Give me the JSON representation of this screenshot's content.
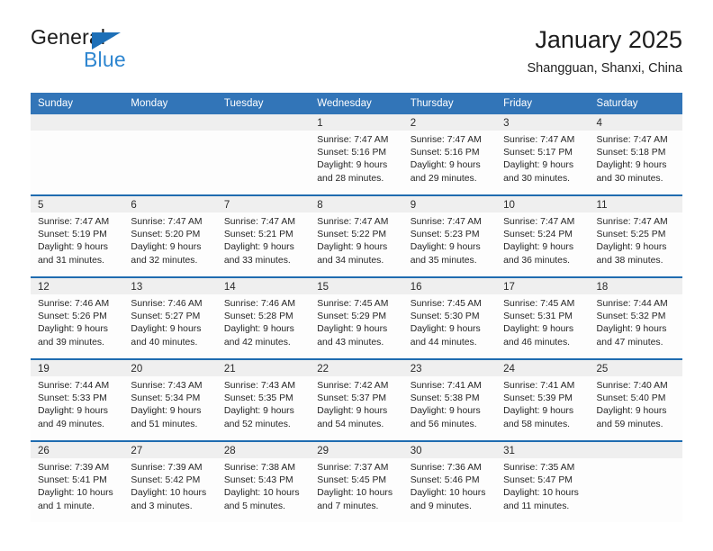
{
  "brand": {
    "name_top": "General",
    "name_bottom": "Blue",
    "accent_color": "#2e86d0",
    "triangle_color": "#1d6fb7"
  },
  "header": {
    "title": "January 2025",
    "subtitle": "Shangguan, Shanxi, China"
  },
  "theme": {
    "header_blue": "#3275b8",
    "separator_blue": "#1f6cb0",
    "band_gray": "#efefef",
    "cell_white": "#fdfdfd"
  },
  "weekdays": [
    "Sunday",
    "Monday",
    "Tuesday",
    "Wednesday",
    "Thursday",
    "Friday",
    "Saturday"
  ],
  "weeks": [
    [
      {
        "day": "",
        "sunrise": "",
        "sunset": "",
        "daylight_1": "",
        "daylight_2": "",
        "empty": true
      },
      {
        "day": "",
        "sunrise": "",
        "sunset": "",
        "daylight_1": "",
        "daylight_2": "",
        "empty": true
      },
      {
        "day": "",
        "sunrise": "",
        "sunset": "",
        "daylight_1": "",
        "daylight_2": "",
        "empty": true
      },
      {
        "day": "1",
        "sunrise": "Sunrise: 7:47 AM",
        "sunset": "Sunset: 5:16 PM",
        "daylight_1": "Daylight: 9 hours",
        "daylight_2": "and 28 minutes."
      },
      {
        "day": "2",
        "sunrise": "Sunrise: 7:47 AM",
        "sunset": "Sunset: 5:16 PM",
        "daylight_1": "Daylight: 9 hours",
        "daylight_2": "and 29 minutes."
      },
      {
        "day": "3",
        "sunrise": "Sunrise: 7:47 AM",
        "sunset": "Sunset: 5:17 PM",
        "daylight_1": "Daylight: 9 hours",
        "daylight_2": "and 30 minutes."
      },
      {
        "day": "4",
        "sunrise": "Sunrise: 7:47 AM",
        "sunset": "Sunset: 5:18 PM",
        "daylight_1": "Daylight: 9 hours",
        "daylight_2": "and 30 minutes."
      }
    ],
    [
      {
        "day": "5",
        "sunrise": "Sunrise: 7:47 AM",
        "sunset": "Sunset: 5:19 PM",
        "daylight_1": "Daylight: 9 hours",
        "daylight_2": "and 31 minutes."
      },
      {
        "day": "6",
        "sunrise": "Sunrise: 7:47 AM",
        "sunset": "Sunset: 5:20 PM",
        "daylight_1": "Daylight: 9 hours",
        "daylight_2": "and 32 minutes."
      },
      {
        "day": "7",
        "sunrise": "Sunrise: 7:47 AM",
        "sunset": "Sunset: 5:21 PM",
        "daylight_1": "Daylight: 9 hours",
        "daylight_2": "and 33 minutes."
      },
      {
        "day": "8",
        "sunrise": "Sunrise: 7:47 AM",
        "sunset": "Sunset: 5:22 PM",
        "daylight_1": "Daylight: 9 hours",
        "daylight_2": "and 34 minutes."
      },
      {
        "day": "9",
        "sunrise": "Sunrise: 7:47 AM",
        "sunset": "Sunset: 5:23 PM",
        "daylight_1": "Daylight: 9 hours",
        "daylight_2": "and 35 minutes."
      },
      {
        "day": "10",
        "sunrise": "Sunrise: 7:47 AM",
        "sunset": "Sunset: 5:24 PM",
        "daylight_1": "Daylight: 9 hours",
        "daylight_2": "and 36 minutes."
      },
      {
        "day": "11",
        "sunrise": "Sunrise: 7:47 AM",
        "sunset": "Sunset: 5:25 PM",
        "daylight_1": "Daylight: 9 hours",
        "daylight_2": "and 38 minutes."
      }
    ],
    [
      {
        "day": "12",
        "sunrise": "Sunrise: 7:46 AM",
        "sunset": "Sunset: 5:26 PM",
        "daylight_1": "Daylight: 9 hours",
        "daylight_2": "and 39 minutes."
      },
      {
        "day": "13",
        "sunrise": "Sunrise: 7:46 AM",
        "sunset": "Sunset: 5:27 PM",
        "daylight_1": "Daylight: 9 hours",
        "daylight_2": "and 40 minutes."
      },
      {
        "day": "14",
        "sunrise": "Sunrise: 7:46 AM",
        "sunset": "Sunset: 5:28 PM",
        "daylight_1": "Daylight: 9 hours",
        "daylight_2": "and 42 minutes."
      },
      {
        "day": "15",
        "sunrise": "Sunrise: 7:45 AM",
        "sunset": "Sunset: 5:29 PM",
        "daylight_1": "Daylight: 9 hours",
        "daylight_2": "and 43 minutes."
      },
      {
        "day": "16",
        "sunrise": "Sunrise: 7:45 AM",
        "sunset": "Sunset: 5:30 PM",
        "daylight_1": "Daylight: 9 hours",
        "daylight_2": "and 44 minutes."
      },
      {
        "day": "17",
        "sunrise": "Sunrise: 7:45 AM",
        "sunset": "Sunset: 5:31 PM",
        "daylight_1": "Daylight: 9 hours",
        "daylight_2": "and 46 minutes."
      },
      {
        "day": "18",
        "sunrise": "Sunrise: 7:44 AM",
        "sunset": "Sunset: 5:32 PM",
        "daylight_1": "Daylight: 9 hours",
        "daylight_2": "and 47 minutes."
      }
    ],
    [
      {
        "day": "19",
        "sunrise": "Sunrise: 7:44 AM",
        "sunset": "Sunset: 5:33 PM",
        "daylight_1": "Daylight: 9 hours",
        "daylight_2": "and 49 minutes."
      },
      {
        "day": "20",
        "sunrise": "Sunrise: 7:43 AM",
        "sunset": "Sunset: 5:34 PM",
        "daylight_1": "Daylight: 9 hours",
        "daylight_2": "and 51 minutes."
      },
      {
        "day": "21",
        "sunrise": "Sunrise: 7:43 AM",
        "sunset": "Sunset: 5:35 PM",
        "daylight_1": "Daylight: 9 hours",
        "daylight_2": "and 52 minutes."
      },
      {
        "day": "22",
        "sunrise": "Sunrise: 7:42 AM",
        "sunset": "Sunset: 5:37 PM",
        "daylight_1": "Daylight: 9 hours",
        "daylight_2": "and 54 minutes."
      },
      {
        "day": "23",
        "sunrise": "Sunrise: 7:41 AM",
        "sunset": "Sunset: 5:38 PM",
        "daylight_1": "Daylight: 9 hours",
        "daylight_2": "and 56 minutes."
      },
      {
        "day": "24",
        "sunrise": "Sunrise: 7:41 AM",
        "sunset": "Sunset: 5:39 PM",
        "daylight_1": "Daylight: 9 hours",
        "daylight_2": "and 58 minutes."
      },
      {
        "day": "25",
        "sunrise": "Sunrise: 7:40 AM",
        "sunset": "Sunset: 5:40 PM",
        "daylight_1": "Daylight: 9 hours",
        "daylight_2": "and 59 minutes."
      }
    ],
    [
      {
        "day": "26",
        "sunrise": "Sunrise: 7:39 AM",
        "sunset": "Sunset: 5:41 PM",
        "daylight_1": "Daylight: 10 hours",
        "daylight_2": "and 1 minute."
      },
      {
        "day": "27",
        "sunrise": "Sunrise: 7:39 AM",
        "sunset": "Sunset: 5:42 PM",
        "daylight_1": "Daylight: 10 hours",
        "daylight_2": "and 3 minutes."
      },
      {
        "day": "28",
        "sunrise": "Sunrise: 7:38 AM",
        "sunset": "Sunset: 5:43 PM",
        "daylight_1": "Daylight: 10 hours",
        "daylight_2": "and 5 minutes."
      },
      {
        "day": "29",
        "sunrise": "Sunrise: 7:37 AM",
        "sunset": "Sunset: 5:45 PM",
        "daylight_1": "Daylight: 10 hours",
        "daylight_2": "and 7 minutes."
      },
      {
        "day": "30",
        "sunrise": "Sunrise: 7:36 AM",
        "sunset": "Sunset: 5:46 PM",
        "daylight_1": "Daylight: 10 hours",
        "daylight_2": "and 9 minutes."
      },
      {
        "day": "31",
        "sunrise": "Sunrise: 7:35 AM",
        "sunset": "Sunset: 5:47 PM",
        "daylight_1": "Daylight: 10 hours",
        "daylight_2": "and 11 minutes."
      },
      {
        "day": "",
        "sunrise": "",
        "sunset": "",
        "daylight_1": "",
        "daylight_2": "",
        "empty": true
      }
    ]
  ]
}
